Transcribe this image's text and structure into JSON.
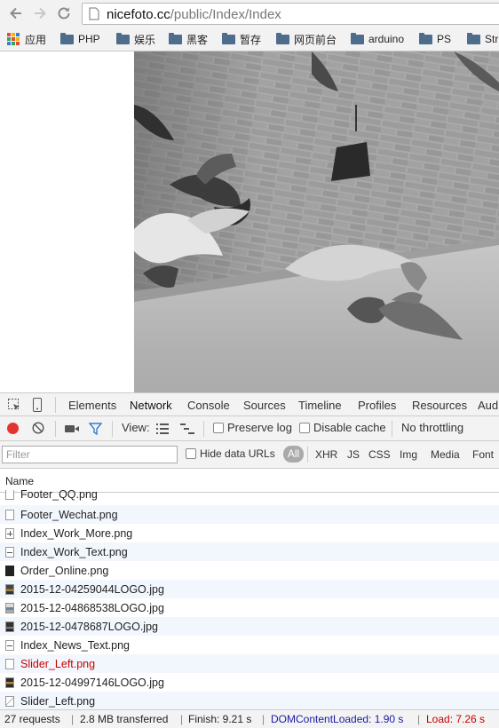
{
  "browser": {
    "url_host": "nicefoto.cc",
    "url_path": "/public/Index/Index",
    "back_icon": "back-arrow-icon",
    "forward_icon": "forward-arrow-icon",
    "reload_icon": "reload-icon"
  },
  "bookmarks": {
    "items": [
      {
        "label": "应用",
        "icon": "apps-grid-icon"
      },
      {
        "label": "PHP",
        "icon": "folder-icon"
      },
      {
        "label": "娱乐",
        "icon": "folder-icon"
      },
      {
        "label": "黑客",
        "icon": "folder-icon"
      },
      {
        "label": "暂存",
        "icon": "folder-icon"
      },
      {
        "label": "网页前台",
        "icon": "folder-icon"
      },
      {
        "label": "arduino",
        "icon": "folder-icon"
      },
      {
        "label": "PS",
        "icon": "folder-icon"
      },
      {
        "label": "Stru",
        "icon": "folder-icon"
      }
    ]
  },
  "page": {
    "image_icon": "pigeons-photo"
  },
  "devtools": {
    "tabs": [
      "Elements",
      "Network",
      "Console",
      "Sources",
      "Timeline",
      "Profiles",
      "Resources",
      "Aud"
    ],
    "active_tab": "Network",
    "toolbar": {
      "view_label": "View:",
      "preserve_log": "Preserve log",
      "disable_cache": "Disable cache",
      "throttling": "No throttling"
    },
    "filter": {
      "placeholder": "Filter",
      "hide_data_urls": "Hide data URLs",
      "types": [
        "All",
        "XHR",
        "JS",
        "CSS",
        "Img",
        "Media",
        "Font"
      ]
    },
    "column_header": "Name",
    "requests": [
      {
        "name": "Footer_QQ.png",
        "icon": "blank-file-icon",
        "error": false
      },
      {
        "name": "Footer_Wechat.png",
        "icon": "blank-file-icon",
        "error": false
      },
      {
        "name": "Index_Work_More.png",
        "icon": "plus-image-icon",
        "error": false
      },
      {
        "name": "Index_Work_Text.png",
        "icon": "line-image-icon",
        "error": false
      },
      {
        "name": "Order_Online.png",
        "icon": "dark-image-icon",
        "error": false
      },
      {
        "name": "2015-12-04259044LOGO.jpg",
        "icon": "photo-thumb-icon",
        "error": false
      },
      {
        "name": "2015-12-04868538LOGO.jpg",
        "icon": "photo-thumb-icon",
        "error": false
      },
      {
        "name": "2015-12-0478687LOGO.jpg",
        "icon": "photo-thumb-icon",
        "error": false
      },
      {
        "name": "Index_News_Text.png",
        "icon": "line-image-icon",
        "error": false
      },
      {
        "name": "Slider_Left.png",
        "icon": "blank-file-icon",
        "error": true
      },
      {
        "name": "2015-12-04997146LOGO.jpg",
        "icon": "photo-thumb-icon",
        "error": false
      },
      {
        "name": "Slider_Left.png",
        "icon": "broken-image-icon",
        "error": false
      }
    ],
    "status": {
      "requests": "27 requests",
      "transferred": "2.8 MB transferred",
      "finish": "Finish: 9.21 s",
      "dom_loaded": "DOMContentLoaded: 1.90 s",
      "load": "Load: 7.26 s",
      "dom_color": "#1a1aa6",
      "load_color": "#c80000"
    }
  }
}
